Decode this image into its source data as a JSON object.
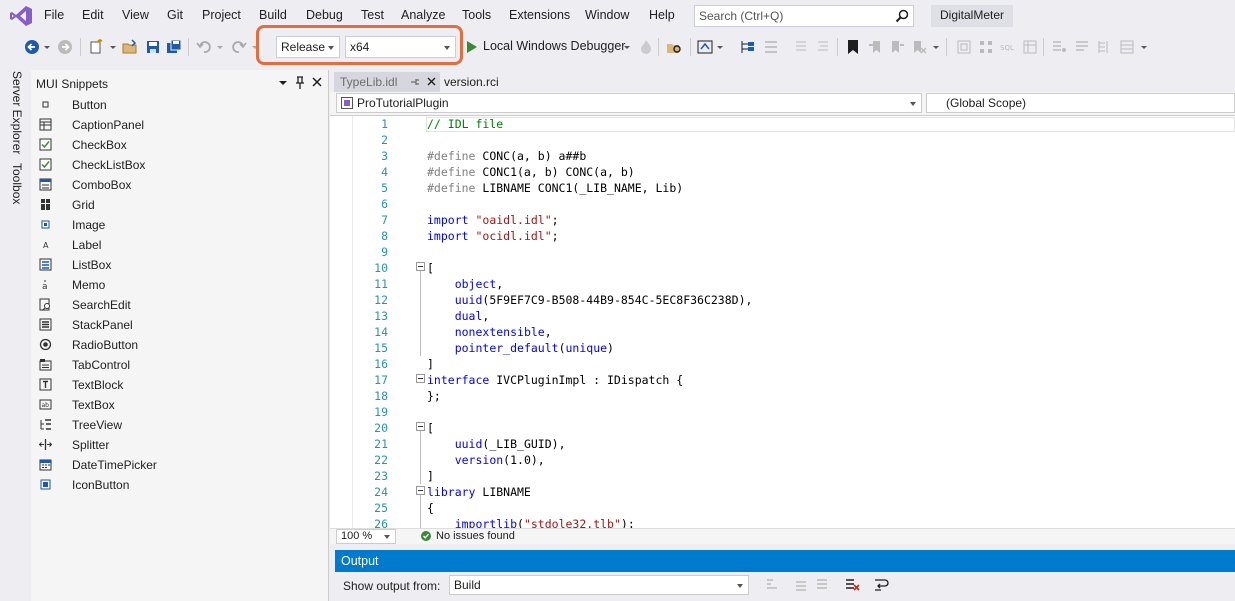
{
  "menu": [
    "File",
    "Edit",
    "View",
    "Git",
    "Project",
    "Build",
    "Debug",
    "Test",
    "Analyze",
    "Tools",
    "Extensions",
    "Window",
    "Help"
  ],
  "search": {
    "placeholder": "Search (Ctrl+Q)"
  },
  "solution_name": "DigitalMeter",
  "toolbar": {
    "configuration": "Release",
    "platform": "x64",
    "run_label": "Local Windows Debugger"
  },
  "vertical_tabs": [
    "Server Explorer",
    "Toolbox"
  ],
  "snippets_panel": {
    "title": "MUI Snippets",
    "items": [
      "Button",
      "CaptionPanel",
      "CheckBox",
      "CheckListBox",
      "ComboBox",
      "Grid",
      "Image",
      "Label",
      "ListBox",
      "Memo",
      "SearchEdit",
      "StackPanel",
      "RadioButton",
      "TabControl",
      "TextBlock",
      "TextBox",
      "TreeView",
      "Splitter",
      "DateTimePicker",
      "IconButton"
    ]
  },
  "editor": {
    "tabs": [
      "TypeLib.idl",
      "version.rci"
    ],
    "nav_left": "ProTutorialPlugin",
    "nav_right": "(Global Scope)",
    "lines": [
      {
        "n": "1",
        "t": "// IDL file"
      },
      {
        "n": "2",
        "t": ""
      },
      {
        "n": "3",
        "t": "#define CONC(a, b) a##b"
      },
      {
        "n": "4",
        "t": "#define CONC1(a, b) CONC(a, b)"
      },
      {
        "n": "5",
        "t": "#define LIBNAME CONC1(_LIB_NAME, Lib)"
      },
      {
        "n": "6",
        "t": ""
      },
      {
        "n": "7",
        "t": "import \"oaidl.idl\";"
      },
      {
        "n": "8",
        "t": "import \"ocidl.idl\";"
      },
      {
        "n": "9",
        "t": ""
      },
      {
        "n": "10",
        "t": "["
      },
      {
        "n": "11",
        "t": "    object,"
      },
      {
        "n": "12",
        "t": "    uuid(5F9EF7C9-B508-44B9-854C-5EC8F36C238D),"
      },
      {
        "n": "13",
        "t": "    dual,"
      },
      {
        "n": "14",
        "t": "    nonextensible,"
      },
      {
        "n": "15",
        "t": "    pointer_default(unique)"
      },
      {
        "n": "16",
        "t": "]"
      },
      {
        "n": "17",
        "t": "interface IVCPluginImpl : IDispatch {"
      },
      {
        "n": "18",
        "t": "};"
      },
      {
        "n": "19",
        "t": ""
      },
      {
        "n": "20",
        "t": "["
      },
      {
        "n": "21",
        "t": "    uuid(_LIB_GUID),"
      },
      {
        "n": "22",
        "t": "    version(1.0),"
      },
      {
        "n": "23",
        "t": "]"
      },
      {
        "n": "24",
        "t": "library LIBNAME"
      },
      {
        "n": "25",
        "t": "{"
      },
      {
        "n": "26",
        "t": "    importlib(\"stdole32.tlb\");"
      }
    ],
    "zoom": "100 %",
    "issues": "No issues found"
  },
  "output_panel": {
    "title": "Output",
    "show_from_label": "Show output from:",
    "source": "Build"
  },
  "colors": {
    "accent": "#007acc",
    "highlight": "#e56c3f",
    "vs_purple": "#865fc5"
  }
}
